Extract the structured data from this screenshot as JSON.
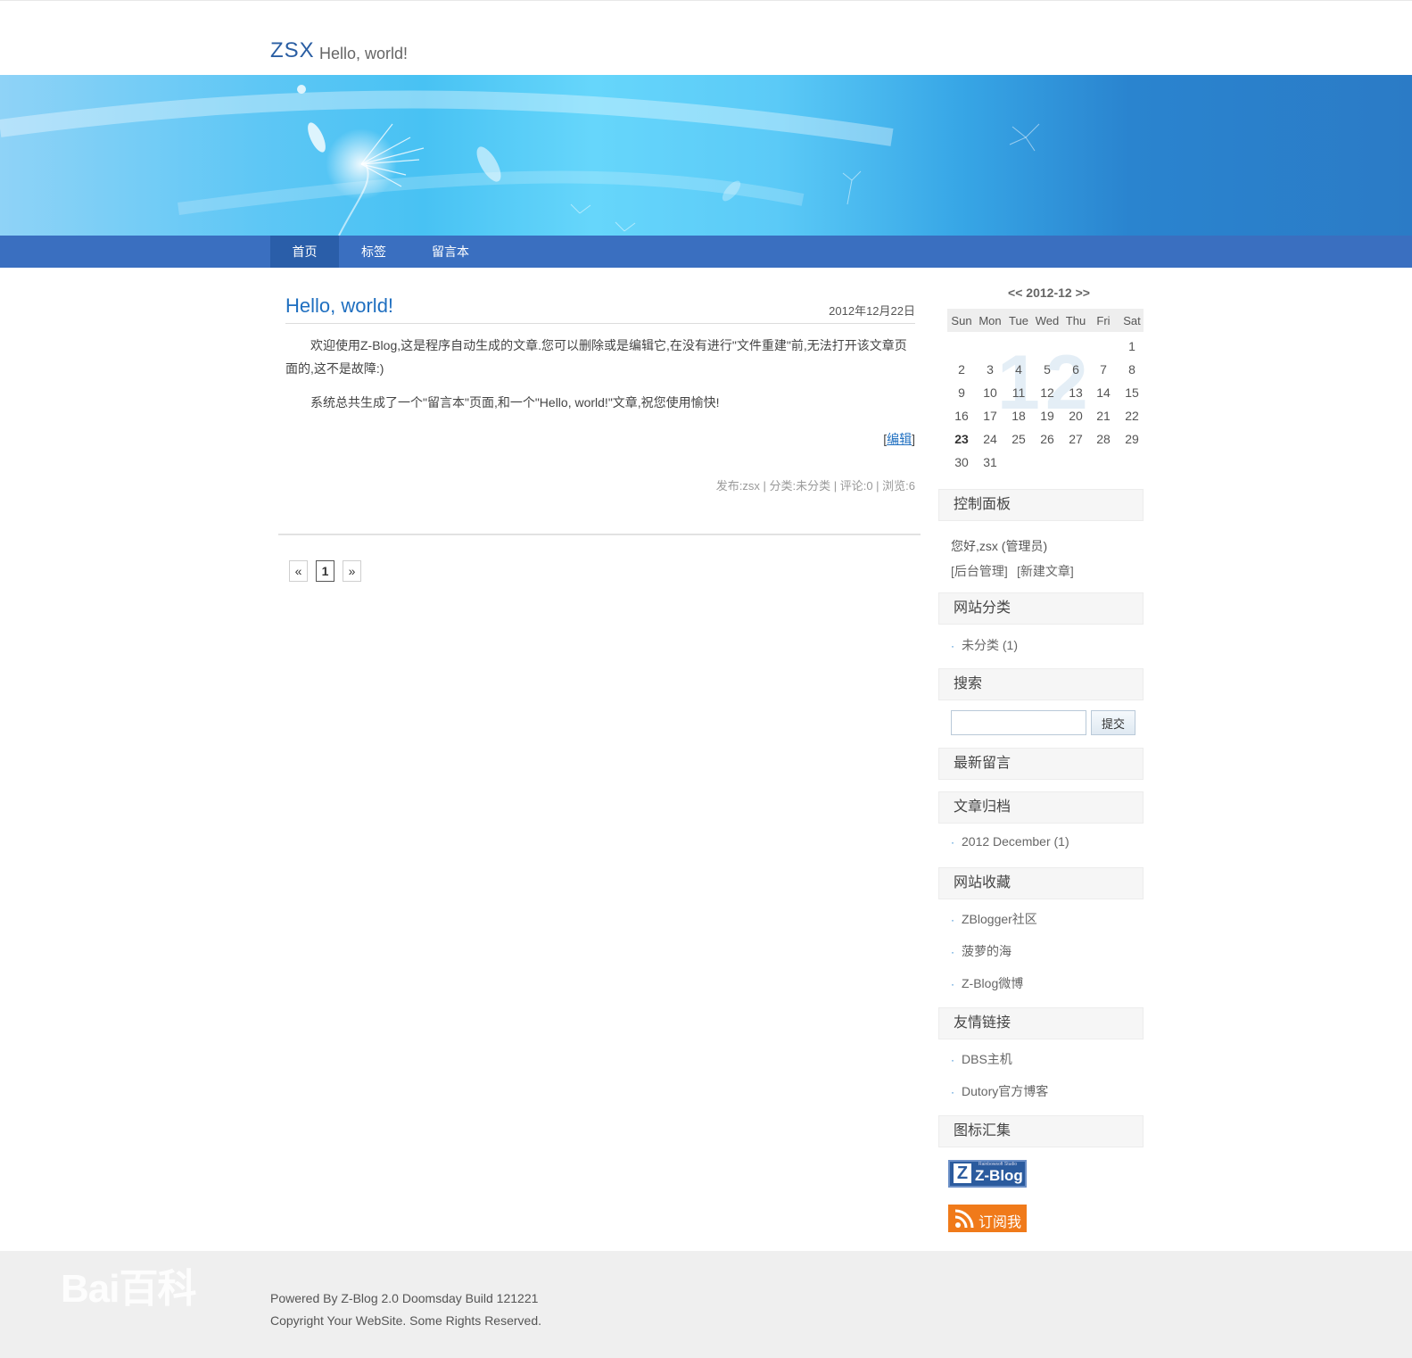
{
  "header": {
    "title": "ZSX",
    "subtitle": "Hello, world!"
  },
  "nav": {
    "items": [
      "首页",
      "标签",
      "留言本"
    ],
    "active": 0
  },
  "post": {
    "title": "Hello, world!",
    "date": "2012年12月22日",
    "paragraphs": [
      "欢迎使用Z-Blog,这是程序自动生成的文章.您可以删除或是编辑它,在没有进行\"文件重建\"前,无法打开该文章页面的,这不是故障:)",
      "系统总共生成了一个\"留言本\"页面,和一个\"Hello, world!\"文章,祝您使用愉快!"
    ],
    "edit_open": "[",
    "edit_label": "编辑",
    "edit_close": "]",
    "meta": "发布:zsx | 分类:未分类 | 评论:0 | 浏览:6"
  },
  "pager": {
    "prev": "«",
    "current": "1",
    "next": "»"
  },
  "calendar": {
    "prev": "<<",
    "title": "2012-12",
    "next": ">>",
    "watermark": "12",
    "days_of_week": [
      "Sun",
      "Mon",
      "Tue",
      "Wed",
      "Thu",
      "Fri",
      "Sat"
    ],
    "weeks": [
      [
        "",
        "",
        "",
        "",
        "",
        "",
        "1"
      ],
      [
        "2",
        "3",
        "4",
        "5",
        "6",
        "7",
        "8"
      ],
      [
        "9",
        "10",
        "11",
        "12",
        "13",
        "14",
        "15"
      ],
      [
        "16",
        "17",
        "18",
        "19",
        "20",
        "21",
        "22"
      ],
      [
        "23",
        "24",
        "25",
        "26",
        "27",
        "28",
        "29"
      ],
      [
        "30",
        "31",
        "",
        "",
        "",
        "",
        ""
      ]
    ],
    "today": "23"
  },
  "sidebar": {
    "control_panel": {
      "title": "控制面板",
      "greeting": "您好,zsx (管理员)",
      "admin_link": "[后台管理]",
      "new_post_link": "[新建文章]"
    },
    "categories": {
      "title": "网站分类",
      "items": [
        "未分类 (1)"
      ]
    },
    "search": {
      "title": "搜索",
      "placeholder": "",
      "button": "提交"
    },
    "latest_comments": {
      "title": "最新留言"
    },
    "archives": {
      "title": "文章归档",
      "items": [
        "2012 December (1)"
      ]
    },
    "favorites": {
      "title": "网站收藏",
      "items": [
        "ZBlogger社区",
        "菠萝的海",
        "Z-Blog微博"
      ]
    },
    "friend_links": {
      "title": "友情链接",
      "items": [
        "DBS主机",
        "Dutory官方博客"
      ]
    },
    "icons": {
      "title": "图标汇集",
      "zblog_badge": "Z-Blog",
      "zblog_small": "Rainbowsoft Studio",
      "zblog_z": "Z",
      "rss_badge": "订阅我"
    }
  },
  "footer": {
    "powered": "Powered By Z-Blog 2.0 Doomsday Build 121221",
    "copyright": "Copyright Your WebSite. Some Rights Reserved."
  },
  "watermark": {
    "text": "Bai百科"
  },
  "colors": {
    "nav": "#3a6fc0",
    "nav_active": "#2a5ea9",
    "link": "#1f6fc0",
    "rss": "#f07a1a",
    "zblog": "#2b5b9e"
  }
}
